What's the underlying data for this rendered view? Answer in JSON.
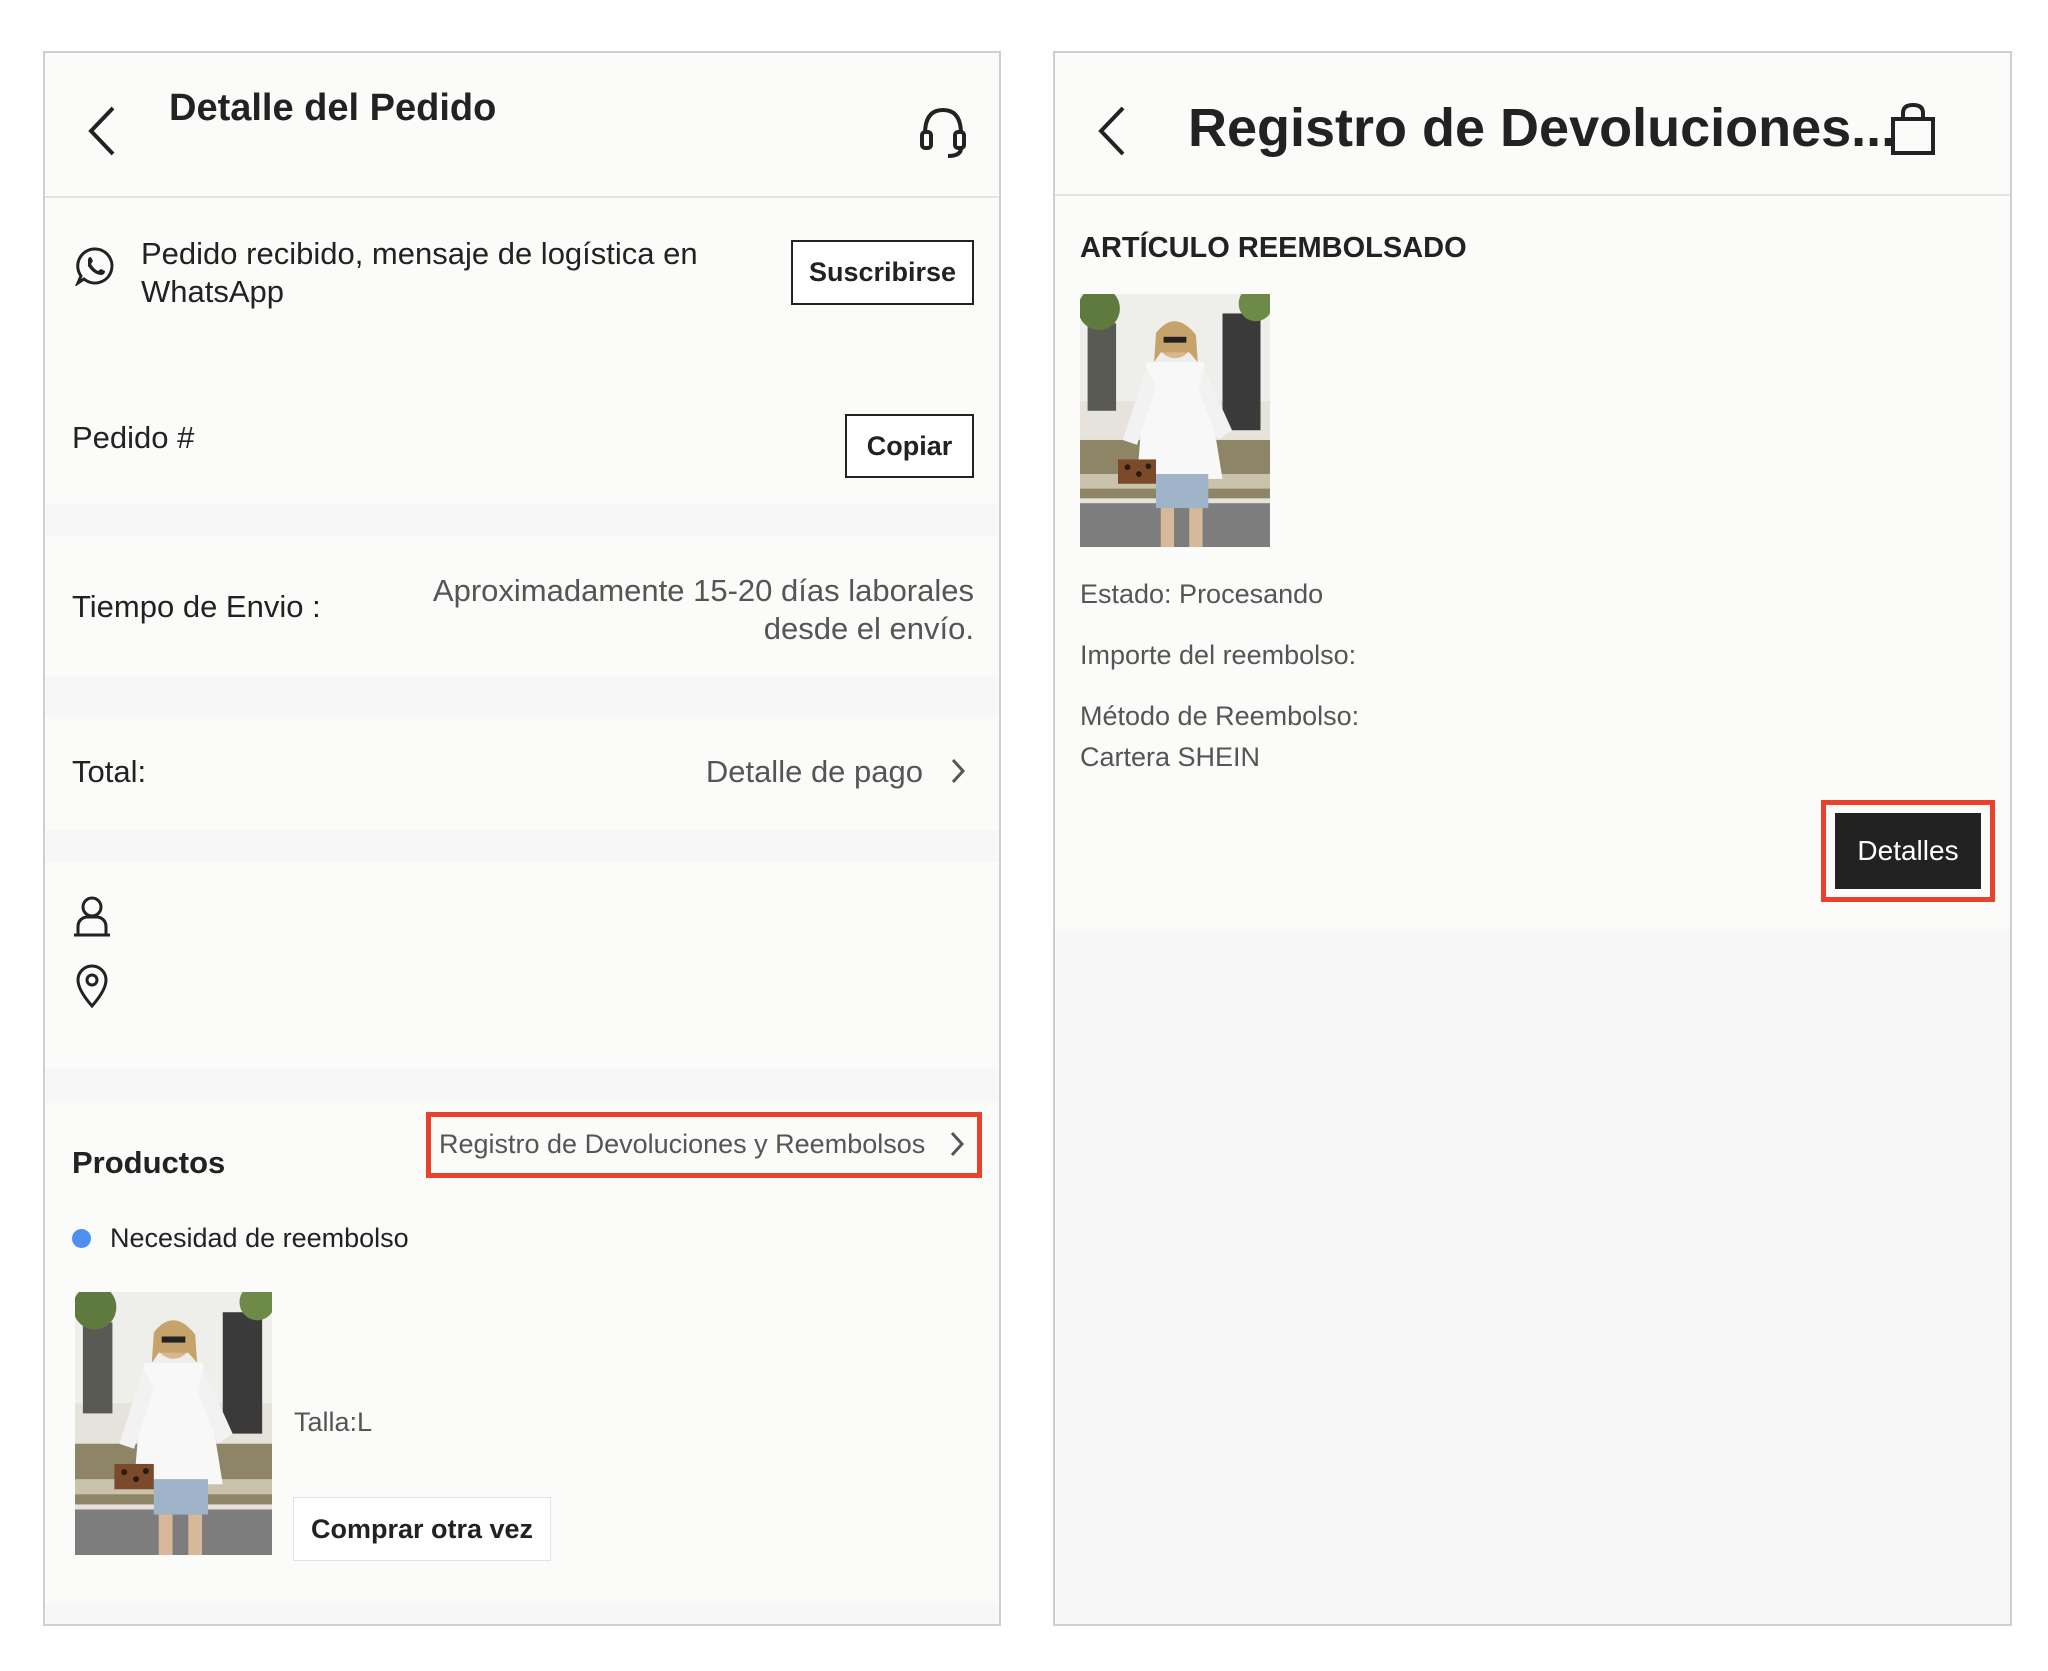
{
  "colors": {
    "highlight": "#e8412c",
    "status_dot": "#4e8ff2",
    "dark_button": "#222222"
  },
  "left": {
    "header": {
      "title": "Detalle del Pedido",
      "back_icon": "chevron-left-icon",
      "support_icon": "headset-icon"
    },
    "whatsapp": {
      "icon": "whatsapp-icon",
      "text": "Pedido recibido, mensaje de logística en WhatsApp",
      "button": "Suscribirse"
    },
    "order": {
      "label": "Pedido #",
      "button": "Copiar"
    },
    "shipping": {
      "label": "Tiempo de Envio :",
      "value": "Aproximadamente 15-20 días laborales desde el envío."
    },
    "total": {
      "label": "Total:",
      "link": "Detalle de pago"
    },
    "address": {
      "person_icon": "user-icon",
      "location_icon": "location-pin-icon"
    },
    "products": {
      "title": "Productos",
      "link": "Registro de Devoluciones y Reembolsos",
      "status": "Necesidad de reembolso",
      "size": "Talla:L",
      "buy_again": "Comprar otra vez"
    }
  },
  "right": {
    "header": {
      "title": "Registro de Devoluciones...",
      "back_icon": "chevron-left-icon",
      "bag_icon": "shopping-bag-icon"
    },
    "section_title": "ARTÍCULO REEMBOLSADO",
    "status": "Estado: Procesando",
    "amount": "Importe del reembolso:",
    "method_label": "Método de Reembolso:",
    "method_value": "Cartera SHEIN",
    "details_button": "Detalles"
  }
}
